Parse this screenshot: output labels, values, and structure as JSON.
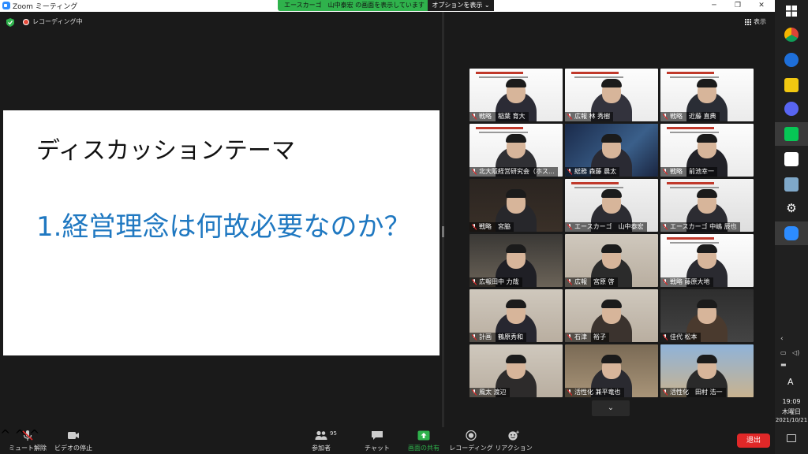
{
  "window": {
    "title": "Zoom ミーティング",
    "minimize_glyph": "─",
    "restore_glyph": "❐",
    "close_glyph": "✕"
  },
  "share_banner": {
    "text": "エースカーゴ　山中泰宏 の画面を表示しています",
    "view_options_label": "オプションを表示 ⌄"
  },
  "status": {
    "recording_label": "レコーディング中",
    "view_label": "表示"
  },
  "slide": {
    "title": "ディスカッションテーマ",
    "point": "1.経営理念は何故必要なのか？"
  },
  "gallery": {
    "participants": [
      {
        "name": "戦略　稲葉 育大"
      },
      {
        "name": "広報  林 秀樹"
      },
      {
        "name": "戦略　近藤 直典"
      },
      {
        "name": "北大阪経営研究会（ホス..."
      },
      {
        "name": "総務 森藤 晨太"
      },
      {
        "name": "戦略　前池幸一"
      },
      {
        "name": "戦略　宮脇"
      },
      {
        "name": "エースカーゴ　山中泰宏"
      },
      {
        "name": "エースカーゴ 中嶋 辰也"
      },
      {
        "name": "広報田中 力哉"
      },
      {
        "name": "広報　宮原 啓"
      },
      {
        "name": "戦略 藤原大地"
      },
      {
        "name": "計画　鶴原秀和"
      },
      {
        "name": "石津　裕子"
      },
      {
        "name": "佳代 松本"
      },
      {
        "name": "風太 渡辺"
      },
      {
        "name": "活性化  兼平竜也"
      },
      {
        "name": "活性化　田村 浩一"
      }
    ],
    "scroll_glyph": "⌄"
  },
  "toolbar": {
    "mute_label": "ミュート解除",
    "video_label": "ビデオの停止",
    "participants_label": "参加者",
    "participants_count": "95",
    "chat_label": "チャット",
    "share_label": "画面の共有",
    "record_label": "レコーディング",
    "reaction_label": "リアクション",
    "leave_label": "退出",
    "caret_glyph": "^"
  },
  "taskbar": {
    "time": "19:09",
    "day": "木曜日",
    "date": "2021/10/21",
    "ime_indicator": "A"
  },
  "colors": {
    "accent_blue": "#1f78c1",
    "banner_green": "#2fb24c",
    "leave_red": "#e02828",
    "share_green": "#2fb24c"
  }
}
